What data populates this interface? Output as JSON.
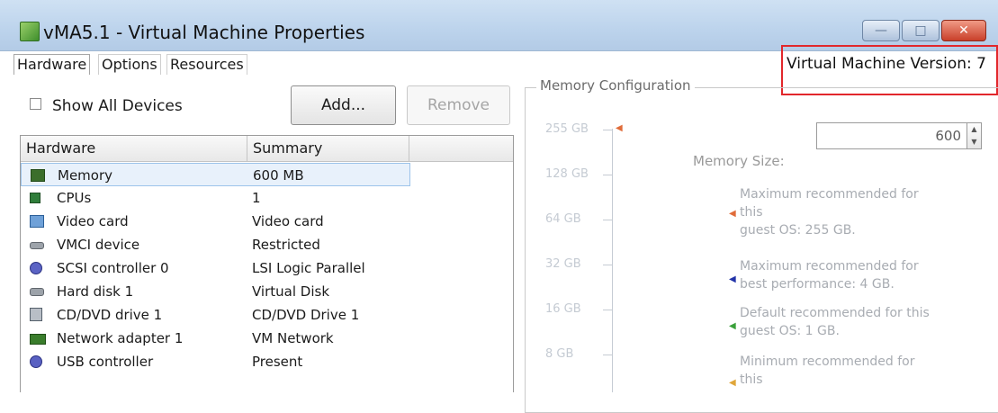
{
  "window": {
    "title": "vMA5.1 - Virtual Machine Properties",
    "min_glyph": "—",
    "max_glyph": "□",
    "close_glyph": "✕"
  },
  "tabs": [
    "Hardware",
    "Options",
    "Resources"
  ],
  "version_label": "Virtual Machine Version: 7",
  "toolbar": {
    "show_all_devices": "Show All Devices",
    "add": "Add...",
    "remove": "Remove"
  },
  "hardware_table": {
    "headers": [
      "Hardware",
      "Summary"
    ],
    "rows": [
      {
        "name": "Memory",
        "summary": "600 MB",
        "icon": "memory-icon"
      },
      {
        "name": "CPUs",
        "summary": "1",
        "icon": "cpu-icon"
      },
      {
        "name": "Video card",
        "summary": "Video card",
        "icon": "video-card-icon"
      },
      {
        "name": "VMCI device",
        "summary": "Restricted",
        "icon": "vmci-device-icon"
      },
      {
        "name": "SCSI controller 0",
        "summary": "LSI Logic Parallel",
        "icon": "scsi-controller-icon"
      },
      {
        "name": "Hard disk 1",
        "summary": "Virtual Disk",
        "icon": "hard-disk-icon"
      },
      {
        "name": "CD/DVD drive 1",
        "summary": "CD/DVD Drive 1",
        "icon": "cd-dvd-icon"
      },
      {
        "name": "Network adapter 1",
        "summary": "VM Network",
        "icon": "network-adapter-icon"
      },
      {
        "name": "USB controller",
        "summary": "Present",
        "icon": "usb-controller-icon"
      }
    ]
  },
  "memory": {
    "legend": "Memory Configuration",
    "axis_labels": [
      "255 GB",
      "128 GB",
      "64 GB",
      "32 GB",
      "16 GB",
      "8 GB"
    ],
    "size_label": "Memory Size:",
    "size_value": "600",
    "spin_up": "▲",
    "spin_down": "▼",
    "recommendations": [
      {
        "lines": [
          "Maximum recommended for",
          "this",
          "guest OS: 255 GB."
        ],
        "color": "#e06c3a"
      },
      {
        "lines": [
          "Maximum recommended for",
          "best performance: 4 GB."
        ],
        "color": "#2233a8"
      },
      {
        "lines": [
          "Default recommended for this",
          "guest OS: 1 GB."
        ],
        "color": "#3aa03a"
      },
      {
        "lines": [
          "Minimum recommended for",
          "this"
        ],
        "color": "#e0a63a"
      }
    ],
    "marker_glyph": "◀"
  },
  "colors": {
    "title_bar": "#bcd3ec",
    "version_highlight": "#e2272b",
    "selected_row": "#e8f1fb"
  }
}
